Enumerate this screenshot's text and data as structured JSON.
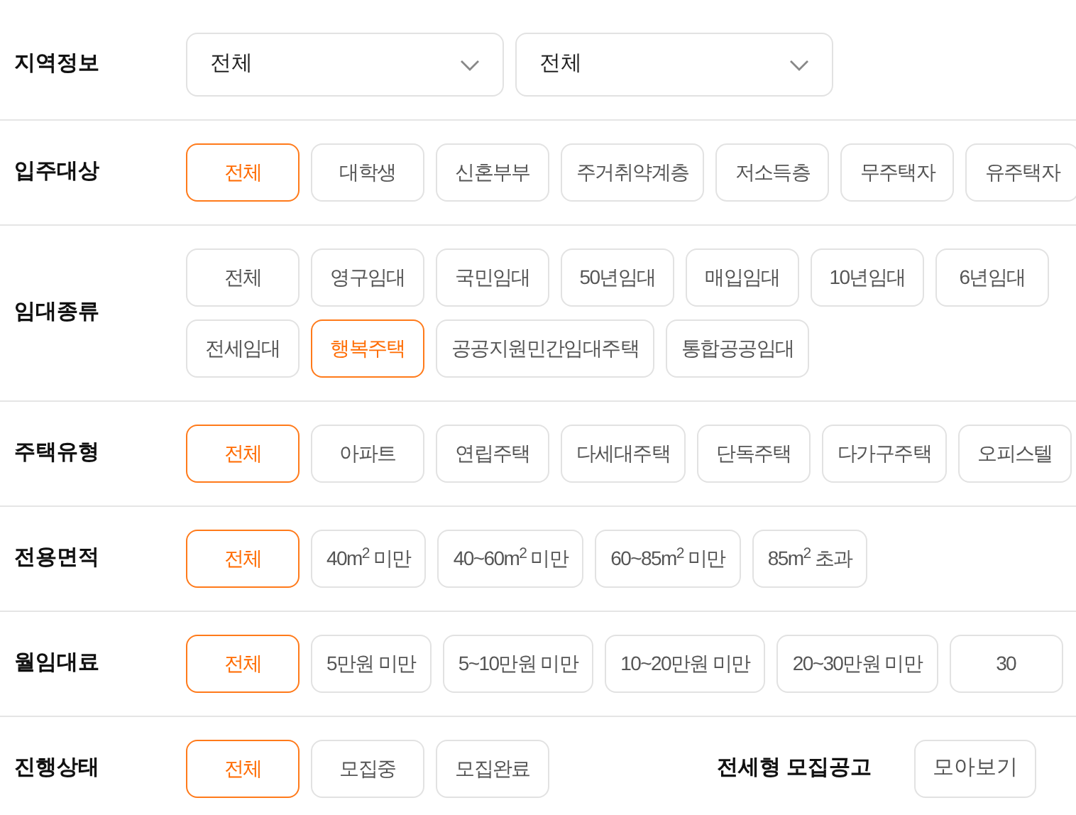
{
  "filters": [
    {
      "kind": "selects",
      "label": "지역정보",
      "selects": [
        {
          "value": "전체"
        },
        {
          "value": "전체"
        }
      ]
    },
    {
      "kind": "chips",
      "label": "입주대상",
      "lines": [
        [
          {
            "label": "전체",
            "selected": true
          },
          {
            "label": "대학생",
            "selected": false
          },
          {
            "label": "신혼부부",
            "selected": false
          },
          {
            "label": "주거취약계층",
            "selected": false
          },
          {
            "label": "저소득층",
            "selected": false
          },
          {
            "label": "무주택자",
            "selected": false
          },
          {
            "label": "유주택자",
            "selected": false
          }
        ]
      ]
    },
    {
      "kind": "chips",
      "label": "임대종류",
      "lines": [
        [
          {
            "label": "전체",
            "selected": false
          },
          {
            "label": "영구임대",
            "selected": false
          },
          {
            "label": "국민임대",
            "selected": false
          },
          {
            "label": "50년임대",
            "selected": false
          },
          {
            "label": "매입임대",
            "selected": false
          },
          {
            "label": "10년임대",
            "selected": false
          },
          {
            "label": "6년임대",
            "selected": false
          }
        ],
        [
          {
            "label": "전세임대",
            "selected": false
          },
          {
            "label": "행복주택",
            "selected": true
          },
          {
            "label": "공공지원민간임대주택",
            "selected": false
          },
          {
            "label": "통합공공임대",
            "selected": false
          }
        ]
      ]
    },
    {
      "kind": "chips",
      "label": "주택유형",
      "lines": [
        [
          {
            "label": "전체",
            "selected": true
          },
          {
            "label": "아파트",
            "selected": false
          },
          {
            "label": "연립주택",
            "selected": false
          },
          {
            "label": "다세대주택",
            "selected": false
          },
          {
            "label": "단독주택",
            "selected": false
          },
          {
            "label": "다가구주택",
            "selected": false
          },
          {
            "label": "오피스텔",
            "selected": false
          }
        ]
      ]
    },
    {
      "kind": "chips",
      "label": "전용면적",
      "lines": [
        [
          {
            "label": "전체",
            "selected": true
          },
          {
            "label": "40m$^{2}$ 미만",
            "selected": false
          },
          {
            "label": "40~60m$^{2}$ 미만",
            "selected": false
          },
          {
            "label": "60~85m$^{2}$ 미만",
            "selected": false
          },
          {
            "label": "85m$^{2}$ 초과",
            "selected": false
          }
        ]
      ]
    },
    {
      "kind": "chips",
      "label": "월임대료",
      "lines": [
        [
          {
            "label": "전체",
            "selected": true
          },
          {
            "label": "5만원 미만",
            "selected": false
          },
          {
            "label": "5~10만원 미만",
            "selected": false
          },
          {
            "label": "10~20만원 미만",
            "selected": false
          },
          {
            "label": "20~30만원 미만",
            "selected": false
          },
          {
            "label": "30",
            "selected": false
          }
        ]
      ]
    },
    {
      "kind": "chips",
      "label": "진행상태",
      "lines": [
        [
          {
            "label": "전체",
            "selected": true
          },
          {
            "label": "모집중",
            "selected": false
          },
          {
            "label": "모집완료",
            "selected": false
          }
        ]
      ],
      "extra": {
        "label": "전세형 모집공고",
        "button": "모아보기"
      }
    }
  ]
}
